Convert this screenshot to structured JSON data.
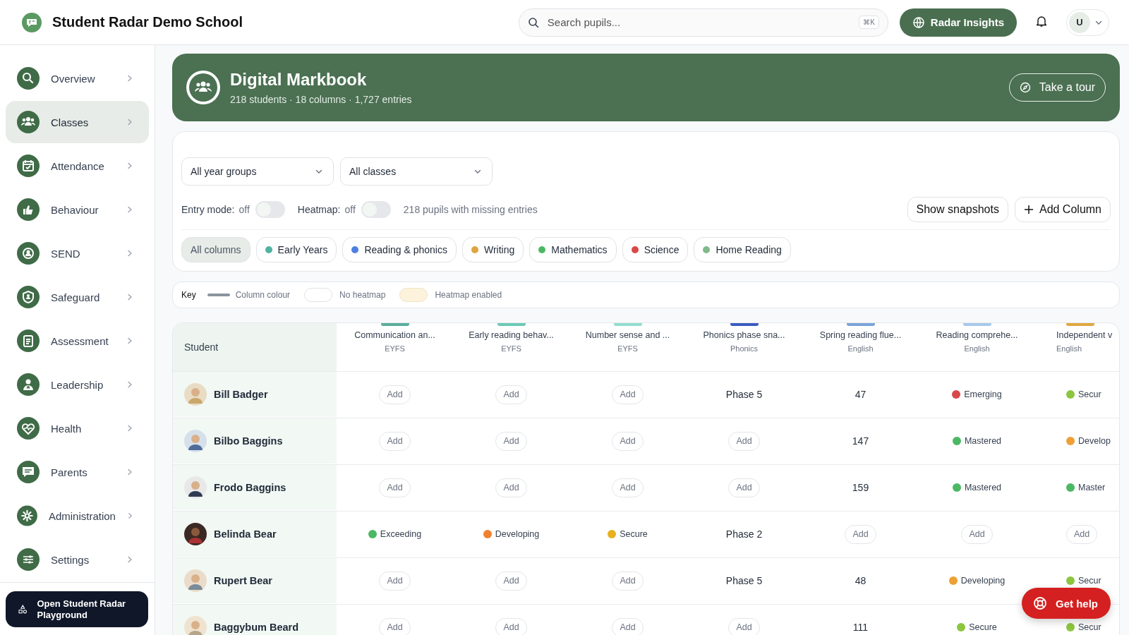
{
  "header": {
    "school_name": "Student Radar Demo School",
    "search": {
      "placeholder": "Search pupils...",
      "shortcut": "⌘K"
    },
    "insights_button": "Radar Insights",
    "user_initial": "U"
  },
  "sidebar": {
    "items": [
      {
        "label": "Overview",
        "selected": false
      },
      {
        "label": "Classes",
        "selected": true
      },
      {
        "label": "Attendance",
        "selected": false
      },
      {
        "label": "Behaviour",
        "selected": false
      },
      {
        "label": "SEND",
        "selected": false
      },
      {
        "label": "Safeguard",
        "selected": false
      },
      {
        "label": "Assessment",
        "selected": false
      },
      {
        "label": "Leadership",
        "selected": false
      },
      {
        "label": "Health",
        "selected": false
      },
      {
        "label": "Parents",
        "selected": false
      },
      {
        "label": "Administration",
        "selected": false
      },
      {
        "label": "Settings",
        "selected": false
      }
    ],
    "playground_button": "Open Student Radar Playground"
  },
  "banner": {
    "title": "Digital Markbook",
    "subtitle": "218 students · 18 columns · 1,727 entries",
    "tour_button": "Take a tour"
  },
  "filters": {
    "dropdowns": [
      "All year groups",
      "All classes"
    ],
    "toggles": [
      {
        "label": "Entry mode:",
        "state_text": "off",
        "on": false
      },
      {
        "label": "Heatmap:",
        "state_text": "off",
        "on": false
      }
    ],
    "missing_note": "218 pupils with missing entries",
    "buttons": [
      {
        "kind": "plain",
        "label": "Show snapshots"
      },
      {
        "kind": "add",
        "label": "Add Column"
      }
    ],
    "chips": [
      {
        "label": "All columns",
        "selected": true
      },
      {
        "label": "Early Years",
        "color": "#4fb3a0",
        "selected": false
      },
      {
        "label": "Reading & phonics",
        "color": "#4f7fe0",
        "selected": false
      },
      {
        "label": "Writing",
        "color": "#e0a440",
        "selected": false
      },
      {
        "label": "Mathematics",
        "color": "#4cb863",
        "selected": false
      },
      {
        "label": "Science",
        "color": "#d94848",
        "selected": false
      },
      {
        "label": "Home Reading",
        "color": "#7fba8a",
        "selected": false
      }
    ]
  },
  "key": {
    "title": "Key",
    "items": [
      {
        "kind": "line",
        "label": "Column colour"
      },
      {
        "kind": "plain",
        "label": "No heatmap"
      },
      {
        "kind": "heat",
        "label": "Heatmap enabled"
      }
    ]
  },
  "table": {
    "student_heading": "Student",
    "columns": [
      {
        "title": "Communication an...",
        "group": "EYFS",
        "color": "#5aae9a"
      },
      {
        "title": "Early reading behav...",
        "group": "EYFS",
        "color": "#6cc9b5"
      },
      {
        "title": "Number sense and ...",
        "group": "EYFS",
        "color": "#92ddd0"
      },
      {
        "title": "Phonics phase sna...",
        "group": "Phonics",
        "color": "#3a5bbf"
      },
      {
        "title": "Spring reading flue...",
        "group": "English",
        "color": "#7ba3d8"
      },
      {
        "title": "Reading comprehe...",
        "group": "English",
        "color": "#a8c8ec"
      },
      {
        "title": "Independent v",
        "group": "English",
        "color": "#e0a840"
      }
    ],
    "rows": [
      {
        "name": "Bill Badger",
        "cells": [
          {
            "kind": "add",
            "text": "Add"
          },
          {
            "kind": "add",
            "text": "Add"
          },
          {
            "kind": "add",
            "text": "Add"
          },
          {
            "kind": "value",
            "text": "Phase 5"
          },
          {
            "kind": "value",
            "text": "47"
          },
          {
            "kind": "status",
            "text": "Emerging",
            "color": "#d94848"
          },
          {
            "kind": "status",
            "text": "Secur",
            "color": "#8cc63f"
          }
        ]
      },
      {
        "name": "Bilbo Baggins",
        "cells": [
          {
            "kind": "add",
            "text": "Add"
          },
          {
            "kind": "add",
            "text": "Add"
          },
          {
            "kind": "add",
            "text": "Add"
          },
          {
            "kind": "add",
            "text": "Add"
          },
          {
            "kind": "value",
            "text": "147"
          },
          {
            "kind": "status",
            "text": "Mastered",
            "color": "#4cb863"
          },
          {
            "kind": "status",
            "text": "Develop",
            "color": "#eea035"
          }
        ]
      },
      {
        "name": "Frodo Baggins",
        "cells": [
          {
            "kind": "add",
            "text": "Add"
          },
          {
            "kind": "add",
            "text": "Add"
          },
          {
            "kind": "add",
            "text": "Add"
          },
          {
            "kind": "add",
            "text": "Add"
          },
          {
            "kind": "value",
            "text": "159"
          },
          {
            "kind": "status",
            "text": "Mastered",
            "color": "#4cb863"
          },
          {
            "kind": "status",
            "text": "Master",
            "color": "#4cb863"
          }
        ]
      },
      {
        "name": "Belinda Bear",
        "cells": [
          {
            "kind": "status",
            "text": "Exceeding",
            "color": "#4cb863"
          },
          {
            "kind": "status",
            "text": "Developing",
            "color": "#f08030"
          },
          {
            "kind": "status",
            "text": "Secure",
            "color": "#e8b020"
          },
          {
            "kind": "value",
            "text": "Phase 2"
          },
          {
            "kind": "add",
            "text": "Add"
          },
          {
            "kind": "add",
            "text": "Add"
          },
          {
            "kind": "add",
            "text": "Add"
          }
        ]
      },
      {
        "name": "Rupert Bear",
        "cells": [
          {
            "kind": "add",
            "text": "Add"
          },
          {
            "kind": "add",
            "text": "Add"
          },
          {
            "kind": "add",
            "text": "Add"
          },
          {
            "kind": "value",
            "text": "Phase 5"
          },
          {
            "kind": "value",
            "text": "48"
          },
          {
            "kind": "status",
            "text": "Developing",
            "color": "#eea035"
          },
          {
            "kind": "status",
            "text": "Secur",
            "color": "#8cc63f"
          }
        ]
      },
      {
        "name": "Baggybum Beard",
        "cells": [
          {
            "kind": "add",
            "text": "Add"
          },
          {
            "kind": "add",
            "text": "Add"
          },
          {
            "kind": "add",
            "text": "Add"
          },
          {
            "kind": "add",
            "text": "Add"
          },
          {
            "kind": "value",
            "text": "111"
          },
          {
            "kind": "status",
            "text": "Secure",
            "color": "#8cc63f"
          },
          {
            "kind": "status",
            "text": "Secur",
            "color": "#8cc63f"
          }
        ]
      }
    ]
  },
  "help_button": "Get help"
}
